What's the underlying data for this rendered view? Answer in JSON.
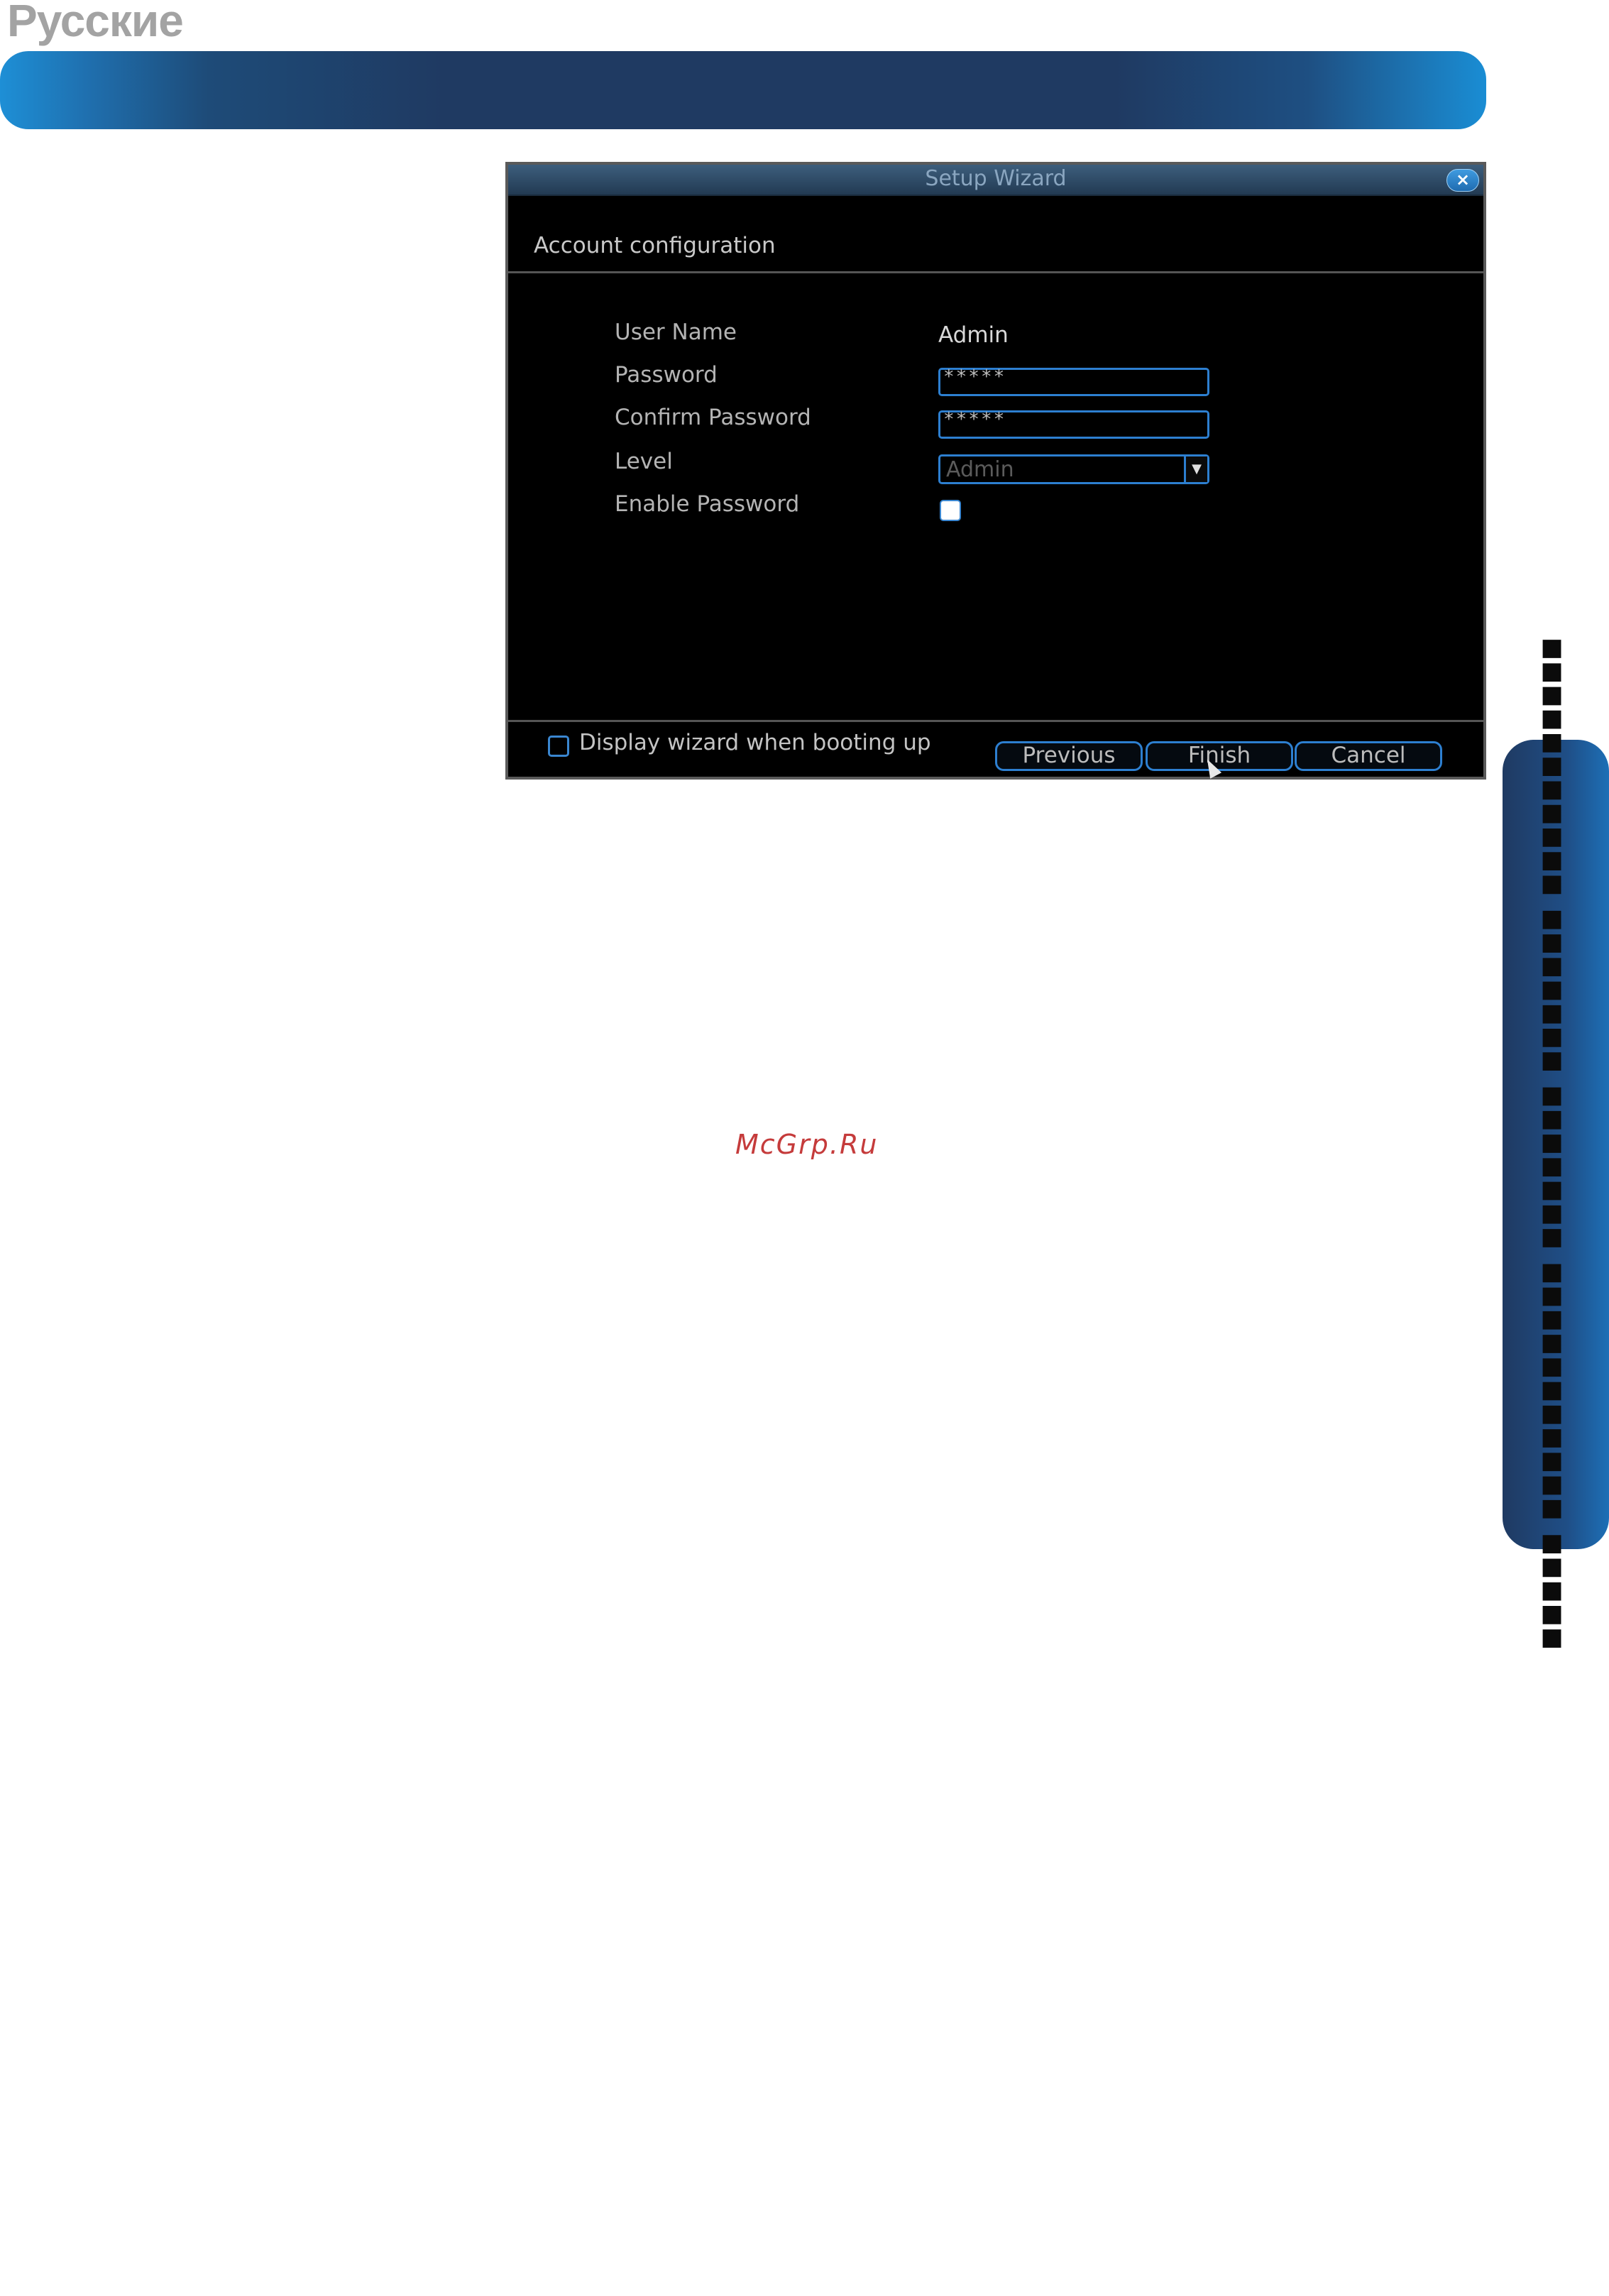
{
  "page": {
    "language_label": "Русские",
    "watermark": "McGrp.Ru",
    "side_tab_text": "▪▪▪▪▪▪▪▪▪▪▪ ▪▪▪▪▪▪▪ ▪▪▪▪▪▪▪ ▪▪▪▪▪▪▪▪▪▪▪ ▪▪▪▪▪"
  },
  "wizard": {
    "title": "Setup Wizard",
    "close_glyph": "×",
    "section_title": "Account configuration",
    "fields": {
      "user_name_label": "User Name",
      "user_name_value": "Admin",
      "password_label": "Password",
      "password_value": "*****",
      "confirm_password_label": "Confirm Password",
      "confirm_password_value": "*****",
      "level_label": "Level",
      "level_value": "Admin",
      "enable_password_label": "Enable Password"
    },
    "footer": {
      "display_wizard_label": "Display wizard when booting up",
      "previous_label": "Previous",
      "finish_label": "Finish",
      "cancel_label": "Cancel"
    }
  },
  "colors": {
    "banner_accent": "#1f3a62",
    "field_border": "#2d7fd0",
    "watermark": "#c53b3b"
  }
}
